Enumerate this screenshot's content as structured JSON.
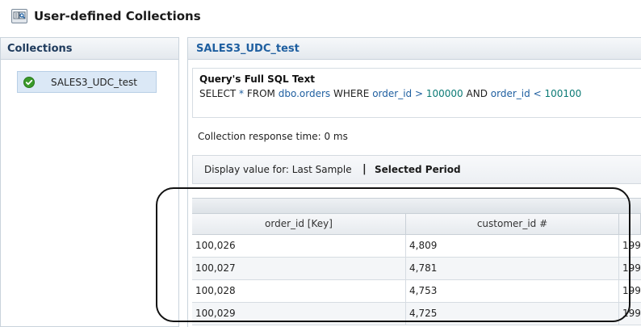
{
  "window": {
    "title": "User-defined Collections",
    "icon": "collections-icon"
  },
  "sidebar": {
    "header": "Collections",
    "items": [
      {
        "label": "SALES3_UDC_test",
        "status": "ok",
        "icon": "check-circle-icon"
      }
    ]
  },
  "main": {
    "header": "SALES3_UDC_test",
    "query": {
      "title": "Query's Full SQL Text",
      "select": "SELECT",
      "star": "*",
      "from": "FROM",
      "table": "dbo.orders",
      "where": "WHERE",
      "col1": "order_id",
      "gt": ">",
      "v1": "100000",
      "and": "AND",
      "col2": "order_id",
      "lt": "<",
      "v2": "100100"
    },
    "response_time": "Collection response time: 0 ms",
    "display": {
      "prefix": "Display value for: Last Sample",
      "separator": "|",
      "selected": "Selected Period"
    },
    "table": {
      "columns": [
        "order_id [Key]",
        "customer_id #",
        ""
      ],
      "rows": [
        [
          "100,026",
          "4,809",
          "199"
        ],
        [
          "100,027",
          "4,781",
          "199"
        ],
        [
          "100,028",
          "4,753",
          "199"
        ],
        [
          "100,029",
          "4,725",
          "199"
        ]
      ]
    }
  },
  "colors": {
    "accent_blue": "#1f5fa0",
    "number_teal": "#0b7a75",
    "selected_bg": "#dbe8f6",
    "ok_green": "#3a9a2a"
  }
}
